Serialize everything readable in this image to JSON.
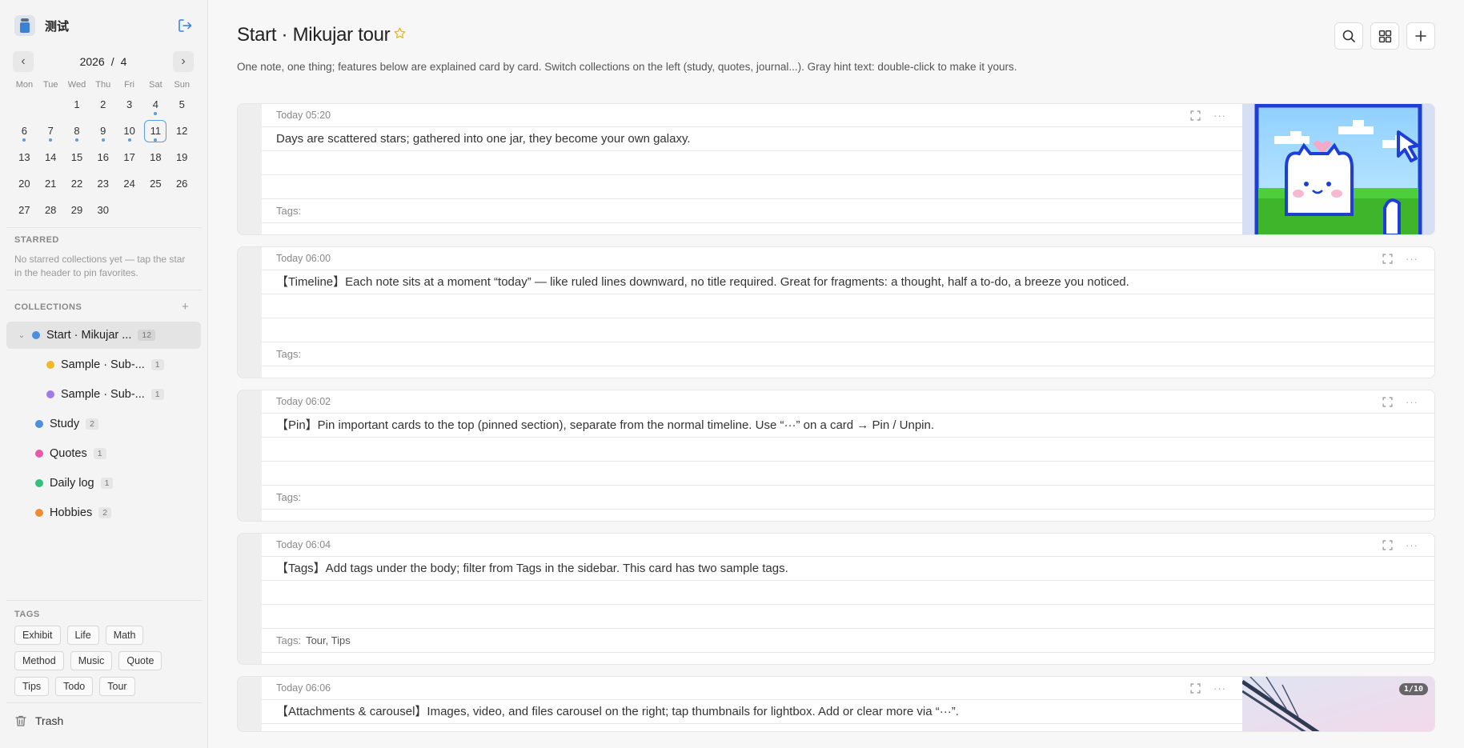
{
  "app": {
    "name": "测试"
  },
  "calendar": {
    "year": "2026",
    "separator": "/",
    "month": "4",
    "weekdays": [
      "Mon",
      "Tue",
      "Wed",
      "Thu",
      "Fri",
      "Sat",
      "Sun"
    ],
    "days": [
      "1",
      "2",
      "3",
      "4",
      "5",
      "6",
      "7",
      "8",
      "9",
      "10",
      "11",
      "12",
      "13",
      "14",
      "15",
      "16",
      "17",
      "18",
      "19",
      "20",
      "21",
      "22",
      "23",
      "24",
      "25",
      "26",
      "27",
      "28",
      "29",
      "30"
    ],
    "today": "11",
    "days_with_notes": [
      "4",
      "6",
      "7",
      "8",
      "9",
      "10",
      "11"
    ]
  },
  "starred": {
    "label": "STARRED",
    "hint": "No starred collections yet — tap the star in the header to pin favorites."
  },
  "collections": {
    "label": "COLLECTIONS",
    "items": [
      {
        "name": "Start · Mikujar ...",
        "count": "12",
        "color": "#4a8fe0"
      },
      {
        "name": "Sample · Sub-...",
        "count": "1",
        "color": "#f2b72a"
      },
      {
        "name": "Sample · Sub-...",
        "count": "1",
        "color": "#a07ce8"
      },
      {
        "name": "Study",
        "count": "2",
        "color": "#4a8fe0"
      },
      {
        "name": "Quotes",
        "count": "1",
        "color": "#e85aa8"
      },
      {
        "name": "Daily log",
        "count": "1",
        "color": "#33c07a"
      },
      {
        "name": "Hobbies",
        "count": "2",
        "color": "#f08a34"
      }
    ]
  },
  "tags": {
    "label": "TAGS",
    "items": [
      "Exhibit",
      "Life",
      "Math",
      "Method",
      "Music",
      "Quote",
      "Tips",
      "Todo",
      "Tour"
    ]
  },
  "trash": {
    "label": "Trash"
  },
  "header": {
    "title": "Start · Mikujar tour",
    "subtitle": "One note, one thing; features below are explained card by card. Switch collections on the left (study, quotes, journal...). Gray hint text: double-click to make it yours."
  },
  "cards": [
    {
      "time": "Today 05:20",
      "body": "Days are scattered stars; gathered into one jar, they become your own galaxy.",
      "tags_label": "Tags:",
      "tags": ""
    },
    {
      "time": "Today 06:00",
      "body": "【Timeline】Each note sits at a moment “today” — like ruled lines downward, no title required. Great for fragments: a thought, half a to-do, a breeze you noticed.",
      "tags_label": "Tags:",
      "tags": ""
    },
    {
      "time": "Today 06:02",
      "body": "【Pin】Pin important cards to the top (pinned section), separate from the normal timeline. Use “···” on a card → Pin / Unpin.",
      "tags_label": "Tags:",
      "tags": ""
    },
    {
      "time": "Today 06:04",
      "body": "【Tags】Add tags under the body; filter from Tags in the sidebar. This card has two sample tags.",
      "tags_label": "Tags:",
      "tags": "Tour,  Tips"
    },
    {
      "time": "Today 06:06",
      "body": "【Attachments & carousel】Images, video, and files carousel on the right; tap thumbnails for lightbox. Add or clear more via “···”.",
      "image_counter": "1/10"
    }
  ],
  "colors": {
    "accent": "#2f7ef0",
    "star": "#e8b820"
  }
}
